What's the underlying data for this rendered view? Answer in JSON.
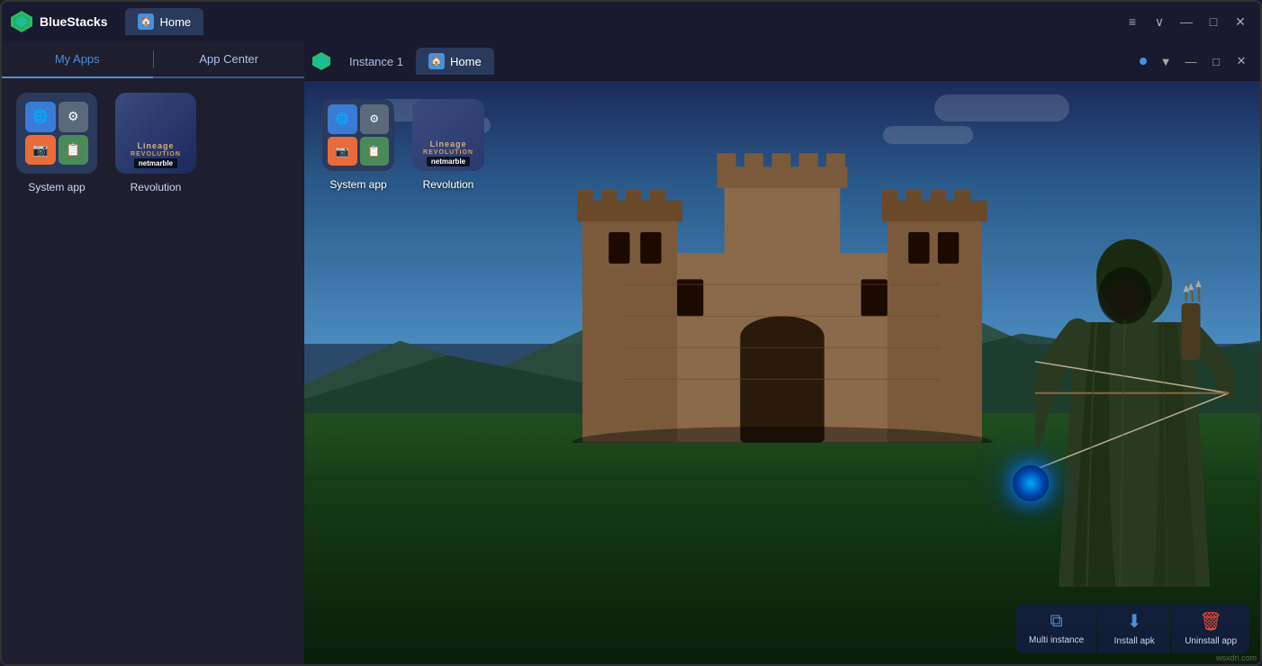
{
  "outer_window": {
    "title": "BlueStacks",
    "tab_home_label": "Home",
    "tab_home_icon": "🏠"
  },
  "sidebar": {
    "my_apps_label": "My Apps",
    "app_center_label": "App Center",
    "apps": [
      {
        "id": "system-app",
        "label": "System app",
        "type": "grid"
      },
      {
        "id": "revolution",
        "label": "Revolution",
        "type": "lineage"
      }
    ]
  },
  "inner_window": {
    "instance_label": "Instance 1",
    "home_label": "Home",
    "indicator_color": "#4a90d9"
  },
  "game_screen": {
    "apps": [
      {
        "id": "system-app-game",
        "label": "System app",
        "type": "grid"
      },
      {
        "id": "revolution-game",
        "label": "Revolution",
        "type": "lineage"
      }
    ]
  },
  "toolbar": {
    "multi_instance_label": "Multi instance",
    "install_apk_label": "Install apk",
    "uninstall_app_label": "Uninstall app"
  },
  "win_controls": {
    "minimize": "—",
    "maximize": "□",
    "close": "✕",
    "dropdown": "∨",
    "menu": "≡"
  },
  "watermark": "wsxdri.com"
}
